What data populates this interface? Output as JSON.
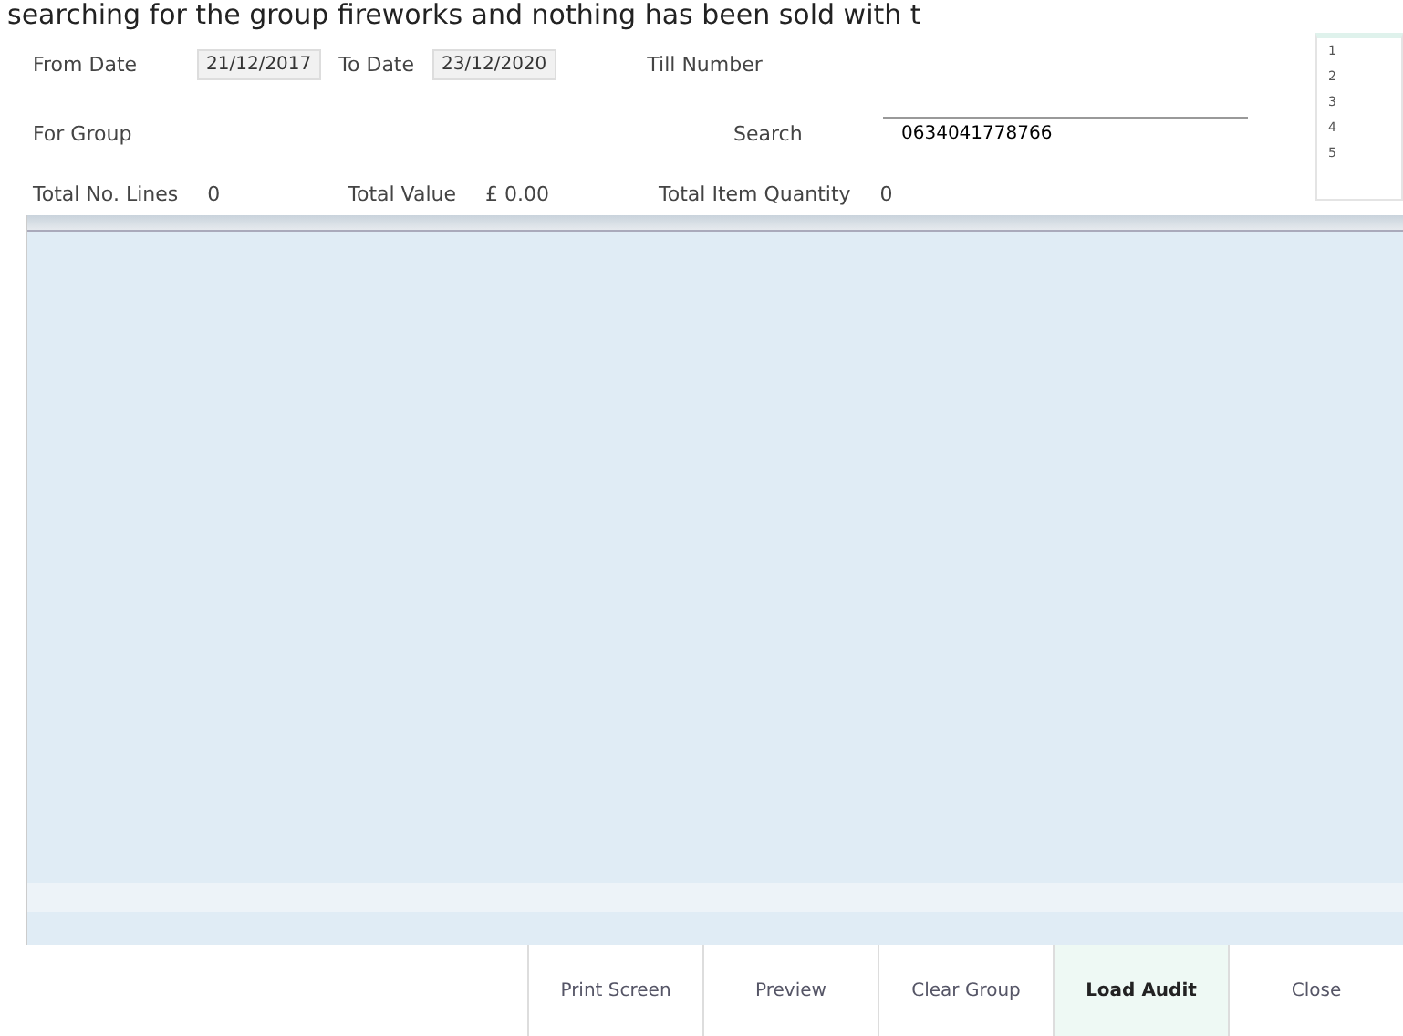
{
  "caption": "searching for the group fireworks and nothing has been sold with t",
  "filters": {
    "from_date": {
      "label": "From Date",
      "value": "21/12/2017"
    },
    "to_date": {
      "label": "To Date",
      "value": "23/12/2020"
    },
    "till_number": {
      "label": "Till Number"
    },
    "for_group": {
      "label": "For Group"
    },
    "search": {
      "label": "Search",
      "value": "0634041778766"
    }
  },
  "till_list": [
    "1",
    "2",
    "3",
    "4",
    "5"
  ],
  "totals": [
    {
      "label": "Total No. Lines",
      "value": "0"
    },
    {
      "label": "Total Value",
      "value": "£ 0.00"
    },
    {
      "label": "Total Item Quantity",
      "value": "0"
    }
  ],
  "buttons": [
    {
      "label": "Print Screen",
      "selected": false
    },
    {
      "label": "Preview",
      "selected": false
    },
    {
      "label": "Clear Group",
      "selected": false
    },
    {
      "label": "Load Audit",
      "selected": true
    },
    {
      "label": "Close",
      "selected": false
    }
  ]
}
